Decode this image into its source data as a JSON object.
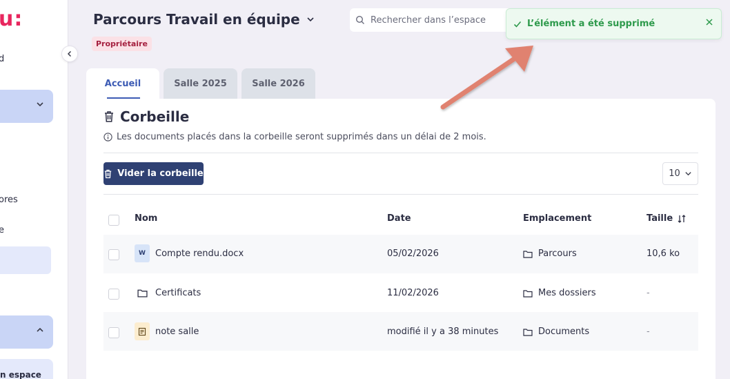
{
  "sidebar": {
    "logo_text": "u:",
    "item_d": "d",
    "item_ores": "ores",
    "item_e": "e",
    "item_espace": "n espace"
  },
  "header": {
    "title": "Parcours Travail en équipe",
    "role_badge": "Propriétaire",
    "search_placeholder": "Rechercher dans l’espace"
  },
  "toast": {
    "message": "L’élément a été supprimé",
    "color": "#2e9a4c"
  },
  "tabs": [
    {
      "label": "Accueil",
      "active": true
    },
    {
      "label": "Salle 2025",
      "active": false
    },
    {
      "label": "Salle 2026",
      "active": false
    }
  ],
  "trash": {
    "heading": "Corbeille",
    "info": "Les documents placés dans la corbeille seront supprimés dans un délai de 2 mois.",
    "empty_button": "Vider la corbeille",
    "page_size": "10"
  },
  "table": {
    "columns": {
      "name": "Nom",
      "date": "Date",
      "location": "Emplacement",
      "size": "Taille"
    },
    "rows": [
      {
        "name": "Compte rendu.docx",
        "icon": "word-file-icon",
        "icon_text": "W",
        "date": "05/02/2026",
        "location": "Parcours",
        "size": "10,6 ko"
      },
      {
        "name": "Certificats",
        "icon": "folder-icon",
        "date": "11/02/2026",
        "location": "Mes dossiers",
        "size": "-"
      },
      {
        "name": "note salle",
        "icon": "note-icon",
        "date": "modifié il y a 38 minutes",
        "location": "Documents",
        "size": "-"
      }
    ]
  },
  "colors": {
    "primary": "#2f4173",
    "accent_tab": "#3c5bb4",
    "brand": "#e8265e",
    "badge_bg": "#fbe1e6",
    "annotation_arrow": "#e0826f"
  }
}
